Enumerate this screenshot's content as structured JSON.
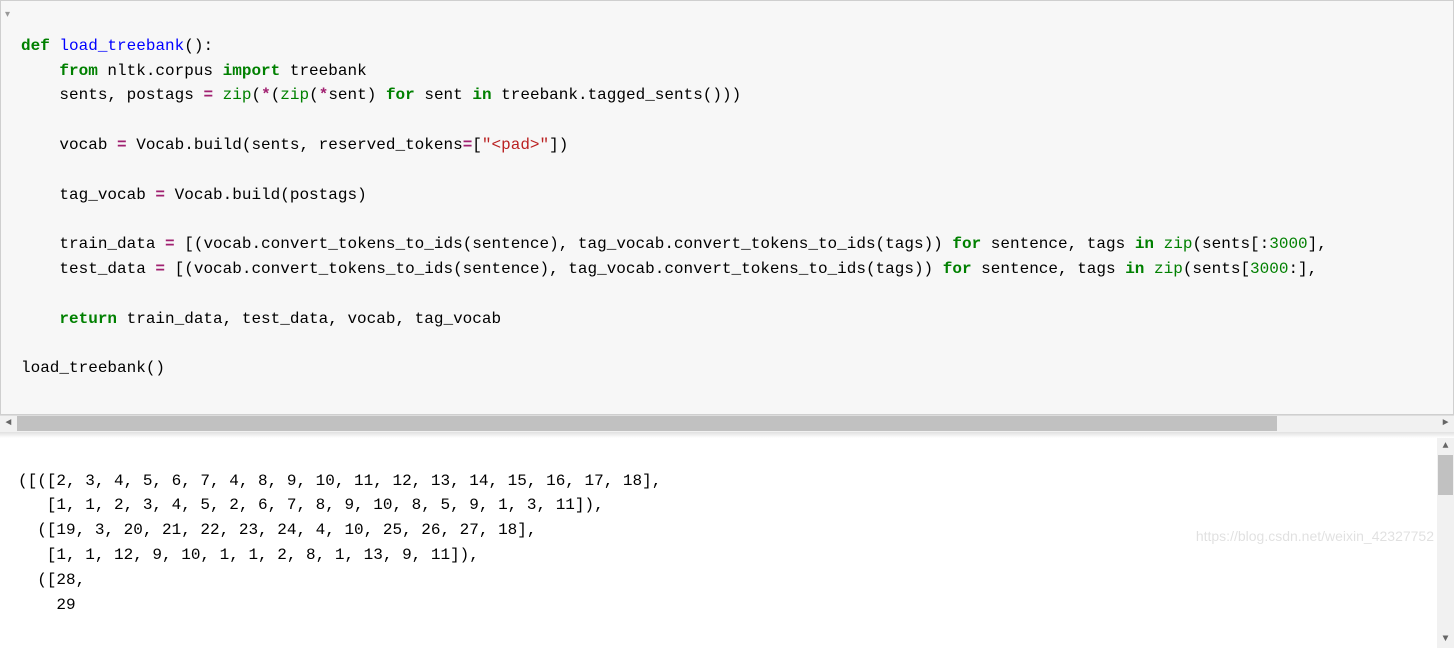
{
  "gutter": {
    "collapse_marker": "▾"
  },
  "code": {
    "l1": {
      "def": "def",
      "name": "load_treebank",
      "tail": "():"
    },
    "l2": {
      "indent": "    ",
      "kw_from": "from",
      "mod": " nltk.corpus ",
      "kw_import": "import",
      "rest": " treebank"
    },
    "l3": {
      "indent": "    ",
      "lhs": "sents, postags ",
      "op1": "=",
      "sp1": " ",
      "zip1": "zip",
      "p1": "(",
      "star1": "*",
      "p2": "(",
      "zip2": "zip",
      "p3": "(",
      "star2": "*",
      "sent": "sent) ",
      "kw_for": "for",
      "sp2": " sent ",
      "kw_in": "in",
      "rest": " treebank.tagged_sents()))"
    },
    "l4": "",
    "l5": {
      "indent": "    ",
      "lhs": "vocab ",
      "op": "=",
      "mid": " Vocab.build(sents, reserved_tokens",
      "op2": "=",
      "br": "[",
      "str": "\"<pad>\"",
      "tail": "])"
    },
    "l6": "",
    "l7": {
      "indent": "    ",
      "lhs": "tag_vocab ",
      "op": "=",
      "rest": " Vocab.build(postags)"
    },
    "l8": "",
    "l9": {
      "indent": "    ",
      "lhs": "train_data ",
      "op": "=",
      "sp": " [(vocab.convert_tokens_to_ids(sentence), tag_vocab.convert_tokens_to_ids(tags)) ",
      "kw_for": "for",
      "mid": " sentence, tags ",
      "kw_in": "in",
      "sp2": " ",
      "zip": "zip",
      "p": "(sents[:",
      "num": "3000",
      "tail": "],"
    },
    "l10": {
      "indent": "    ",
      "lhs": "test_data ",
      "op": "=",
      "sp": " [(vocab.convert_tokens_to_ids(sentence), tag_vocab.convert_tokens_to_ids(tags)) ",
      "kw_for": "for",
      "mid": " sentence, tags ",
      "kw_in": "in",
      "sp2": " ",
      "zip": "zip",
      "p": "(sents[",
      "num": "3000",
      "tail": ":], "
    },
    "l11": "",
    "l12": {
      "indent": "    ",
      "kw_return": "return",
      "rest": " train_data, test_data, vocab, tag_vocab"
    },
    "l13": "",
    "l14": {
      "text": "load_treebank()"
    }
  },
  "output": {
    "lines": [
      "([([2, 3, 4, 5, 6, 7, 4, 8, 9, 10, 11, 12, 13, 14, 15, 16, 17, 18],",
      "   [1, 1, 2, 3, 4, 5, 2, 6, 7, 8, 9, 10, 8, 5, 9, 1, 3, 11]),",
      "  ([19, 3, 20, 21, 22, 23, 24, 4, 10, 25, 26, 27, 18],",
      "   [1, 1, 12, 9, 10, 1, 1, 2, 8, 1, 13, 9, 11]),",
      "  ([28,",
      "    29"
    ]
  },
  "watermark": "https://blog.csdn.net/weixin_42327752"
}
